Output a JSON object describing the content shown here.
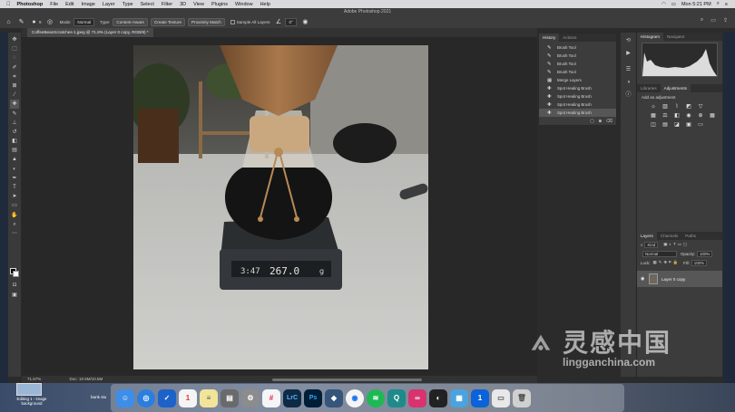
{
  "menubar": {
    "app": "Photoshop",
    "items": [
      "File",
      "Edit",
      "Image",
      "Layer",
      "Type",
      "Select",
      "Filter",
      "3D",
      "View",
      "Plugins",
      "Window",
      "Help"
    ],
    "clock": "Mon 5:21 PM"
  },
  "window": {
    "title": "Adobe Photoshop 2021"
  },
  "options": {
    "brush_size": "9",
    "mode_label": "Mode:",
    "mode_value": "Normal",
    "type_label": "Type:",
    "type_value": "Content-Aware",
    "create_texture": "Create Texture",
    "proximity_match": "Proximity Match",
    "sample_all_layers": "Sample All Layers",
    "angle": "0°"
  },
  "document": {
    "tab_title": "CoffeeBeanScratches-1.jpeg @ 71.8% (Layer 0 copy, RGB/8) *"
  },
  "status": {
    "zoom": "71.67%",
    "doc": "Doc: 10.5M/10.5M"
  },
  "history": {
    "tabs": [
      "History",
      "Actions"
    ],
    "items": [
      "Brush Tool",
      "Brush Tool",
      "Brush Tool",
      "Brush Tool",
      "Merge Layers",
      "Spot Healing Brush",
      "Spot Healing Brush",
      "Spot Healing Brush",
      "Spot Healing Brush"
    ]
  },
  "right": {
    "tabs_top": [
      "Histogram",
      "Navigator"
    ],
    "tabs_mid": [
      "Libraries",
      "Adjustments"
    ],
    "add_adjustment": "Add an adjustment",
    "tabs_layers": [
      "Layers",
      "Channels",
      "Paths"
    ],
    "kind": "Kind",
    "blend": "Normal",
    "opacity_label": "Opacity:",
    "opacity": "100%",
    "lock_label": "Lock:",
    "fill_label": "Fill:",
    "fill": "100%",
    "layer_name": "Layer 0 copy"
  },
  "scale_display": {
    "time": "3:47",
    "weight": "267.0",
    "unit": "g"
  },
  "desktop": {
    "file1": "Editing 1 - image background",
    "file2": "bank stu"
  },
  "dock": [
    "Finder",
    "Safari",
    "Tasks",
    "Calendar",
    "Notes",
    "Files",
    "Settings",
    "Slack",
    "LrC",
    "Ps",
    "App",
    "Chrome",
    "Spotify",
    "Q",
    "CC",
    "Eye",
    "Finder2",
    "1P",
    "Files2",
    "Trash"
  ],
  "watermark": {
    "cn": "灵感中国",
    "en": "lingganchina.com"
  }
}
